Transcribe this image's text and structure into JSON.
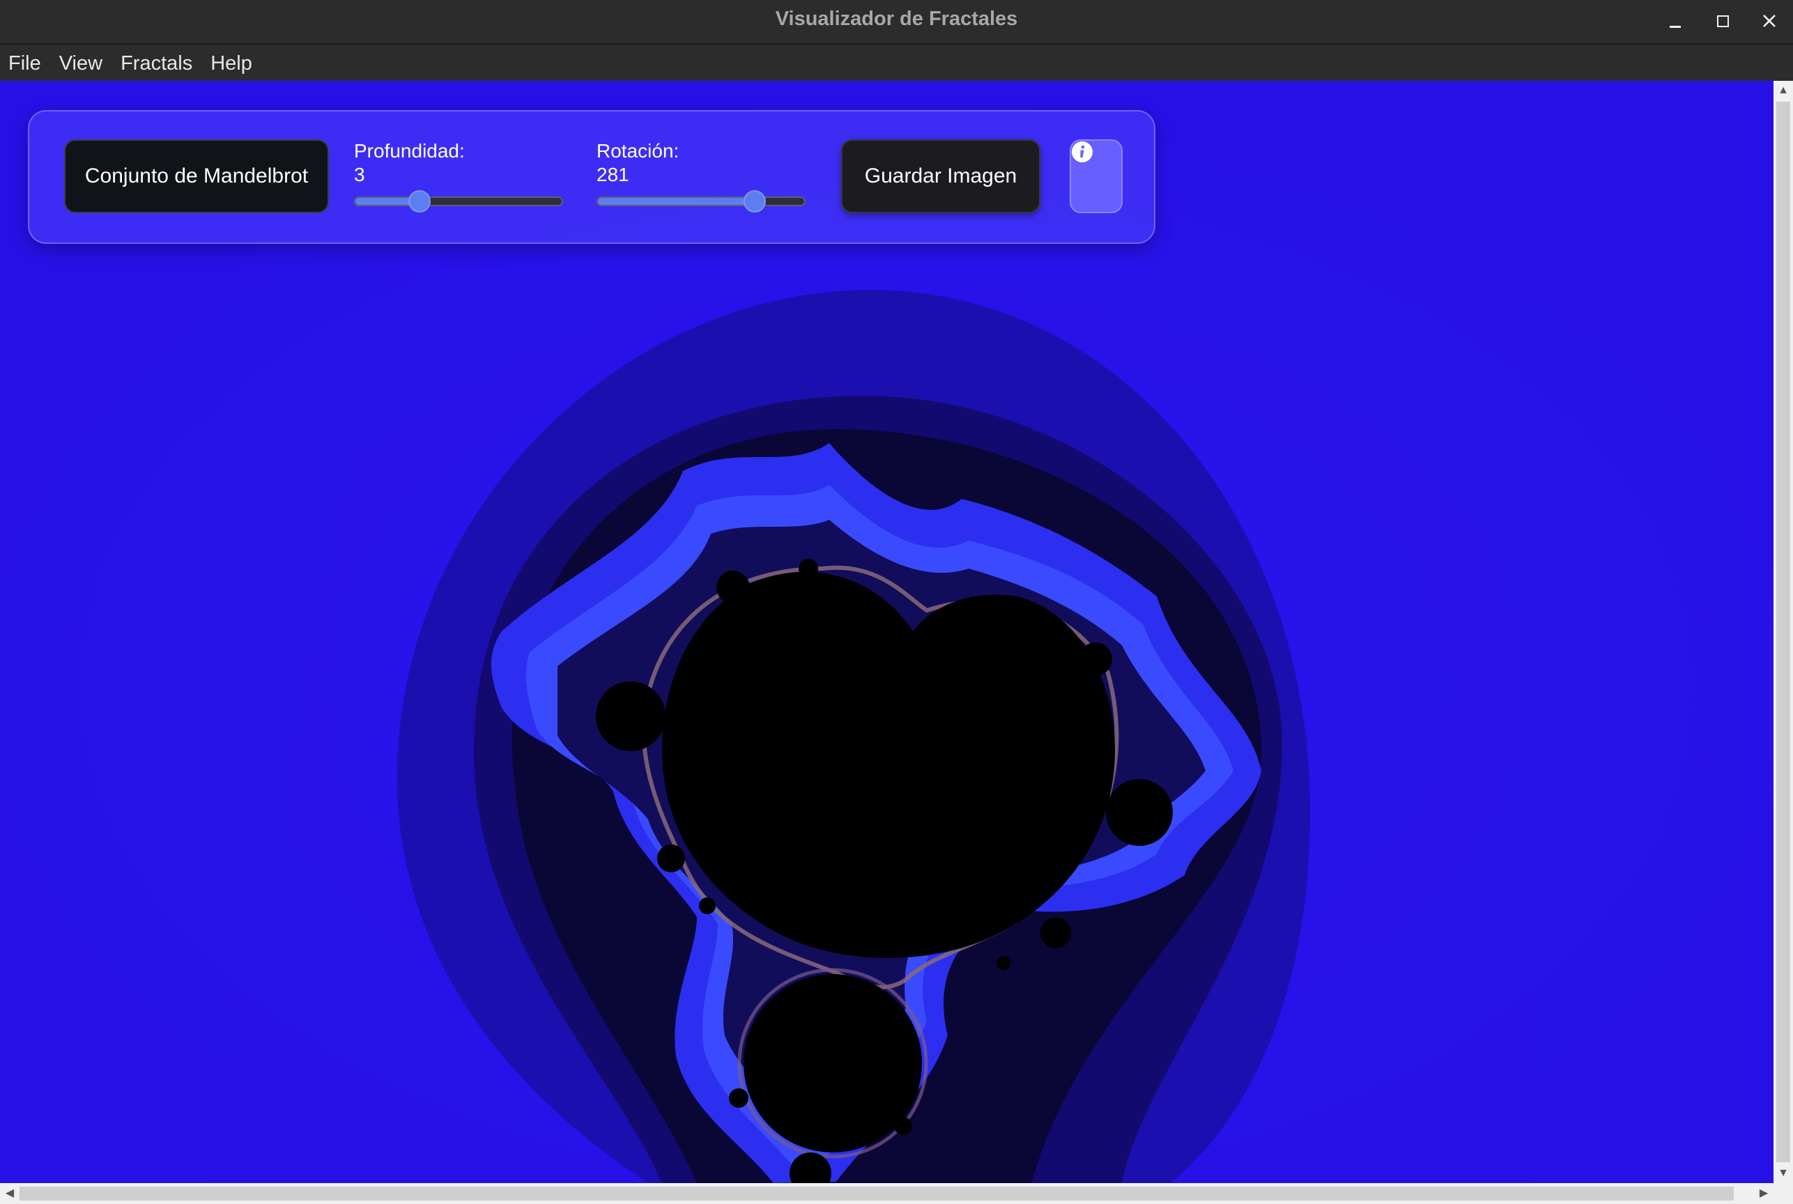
{
  "window": {
    "title": "Visualizador de Fractales"
  },
  "menu": [
    "File",
    "View",
    "Fractals",
    "Help"
  ],
  "controls": {
    "fractal_button": "Conjunto de Mandelbrot",
    "depth": {
      "label": "Profundidad:",
      "value": "3",
      "fraction": 0.31
    },
    "rotation": {
      "label": "Rotación:",
      "value": "281",
      "fraction": 0.76
    },
    "save_button": "Guardar Imagen",
    "info_icon": "info-icon"
  },
  "colors": {
    "background": "#2610e6",
    "panel": "#5046ff",
    "slider_accent": "#5c7ef0",
    "set_interior": "#000000"
  }
}
